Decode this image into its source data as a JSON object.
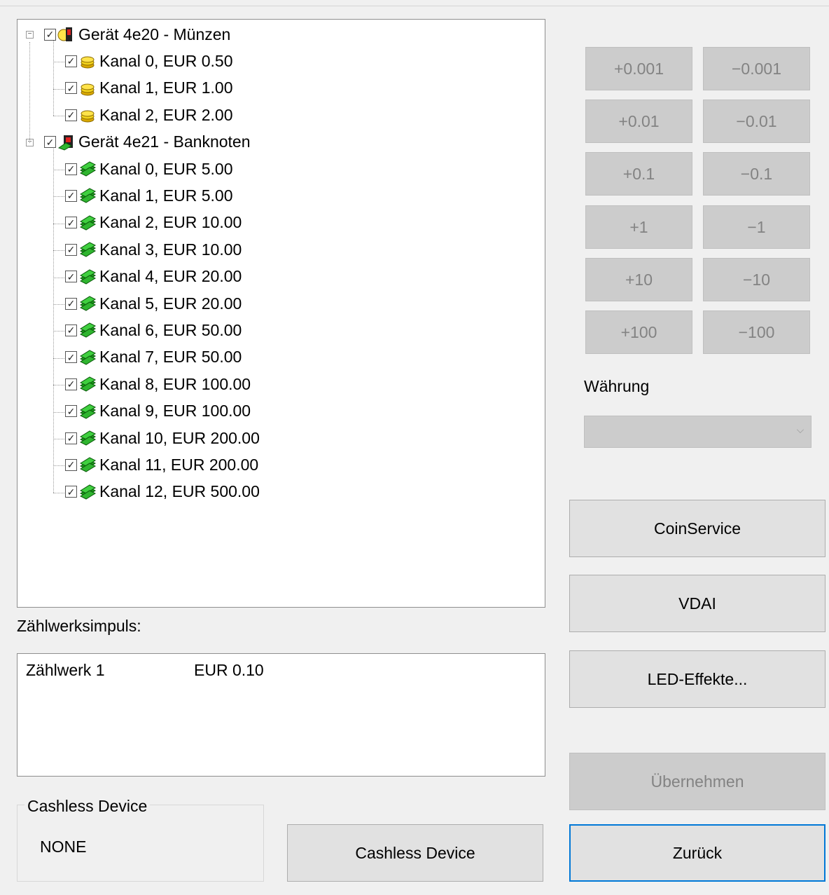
{
  "tree": {
    "devices": [
      {
        "label": "Gerät 4e20 - Münzen",
        "checked": true,
        "icon": "coin-device-icon",
        "channels": [
          {
            "label": "Kanal 0, EUR 0.50",
            "icon": "coin-icon"
          },
          {
            "label": "Kanal 1, EUR 1.00",
            "icon": "coin-icon"
          },
          {
            "label": "Kanal 2, EUR 2.00",
            "icon": "coin-icon"
          }
        ]
      },
      {
        "label": "Gerät 4e21 - Banknoten",
        "checked": true,
        "icon": "banknote-device-icon",
        "channels": [
          {
            "label": "Kanal 0, EUR 5.00",
            "icon": "banknote-icon"
          },
          {
            "label": "Kanal 1, EUR 5.00",
            "icon": "banknote-icon"
          },
          {
            "label": "Kanal 2, EUR 10.00",
            "icon": "banknote-icon"
          },
          {
            "label": "Kanal 3, EUR 10.00",
            "icon": "banknote-icon"
          },
          {
            "label": "Kanal 4, EUR 20.00",
            "icon": "banknote-icon"
          },
          {
            "label": "Kanal 5, EUR 20.00",
            "icon": "banknote-icon"
          },
          {
            "label": "Kanal 6, EUR 50.00",
            "icon": "banknote-icon"
          },
          {
            "label": "Kanal 7, EUR 50.00",
            "icon": "banknote-icon"
          },
          {
            "label": "Kanal 8, EUR 100.00",
            "icon": "banknote-icon"
          },
          {
            "label": "Kanal 9, EUR 100.00",
            "icon": "banknote-icon"
          },
          {
            "label": "Kanal 10, EUR 200.00",
            "icon": "banknote-icon"
          },
          {
            "label": "Kanal 11, EUR 200.00",
            "icon": "banknote-icon"
          },
          {
            "label": "Kanal 12, EUR 500.00",
            "icon": "banknote-icon"
          }
        ]
      }
    ],
    "expander_symbol": "−",
    "check_symbol": "✓"
  },
  "counter": {
    "label": "Zählwerksimpuls:",
    "rows": [
      {
        "name": "Zählwerk 1",
        "value": "EUR 0.10"
      }
    ]
  },
  "cashless": {
    "group_title": "Cashless Device",
    "value": "NONE",
    "button_label": "Cashless Device"
  },
  "adjust_buttons": [
    {
      "plus": "+0.001",
      "minus": "−0.001"
    },
    {
      "plus": "+0.01",
      "minus": "−0.01"
    },
    {
      "plus": "+0.1",
      "minus": "−0.1"
    },
    {
      "plus": "+1",
      "minus": "−1"
    },
    {
      "plus": "+10",
      "minus": "−10"
    },
    {
      "plus": "+100",
      "minus": "−100"
    }
  ],
  "currency": {
    "label": "Währung",
    "selected": ""
  },
  "actions": {
    "coinservice": "CoinService",
    "vdai": "VDAI",
    "led": "LED-Effekte...",
    "apply": "Übernehmen",
    "back": "Zurück"
  },
  "colors": {
    "button_bg": "#e1e1e1",
    "disabled_bg": "#cccccc",
    "focus_border": "#0078d7",
    "coin": "#f2d21b",
    "banknote": "#2fb52f"
  }
}
